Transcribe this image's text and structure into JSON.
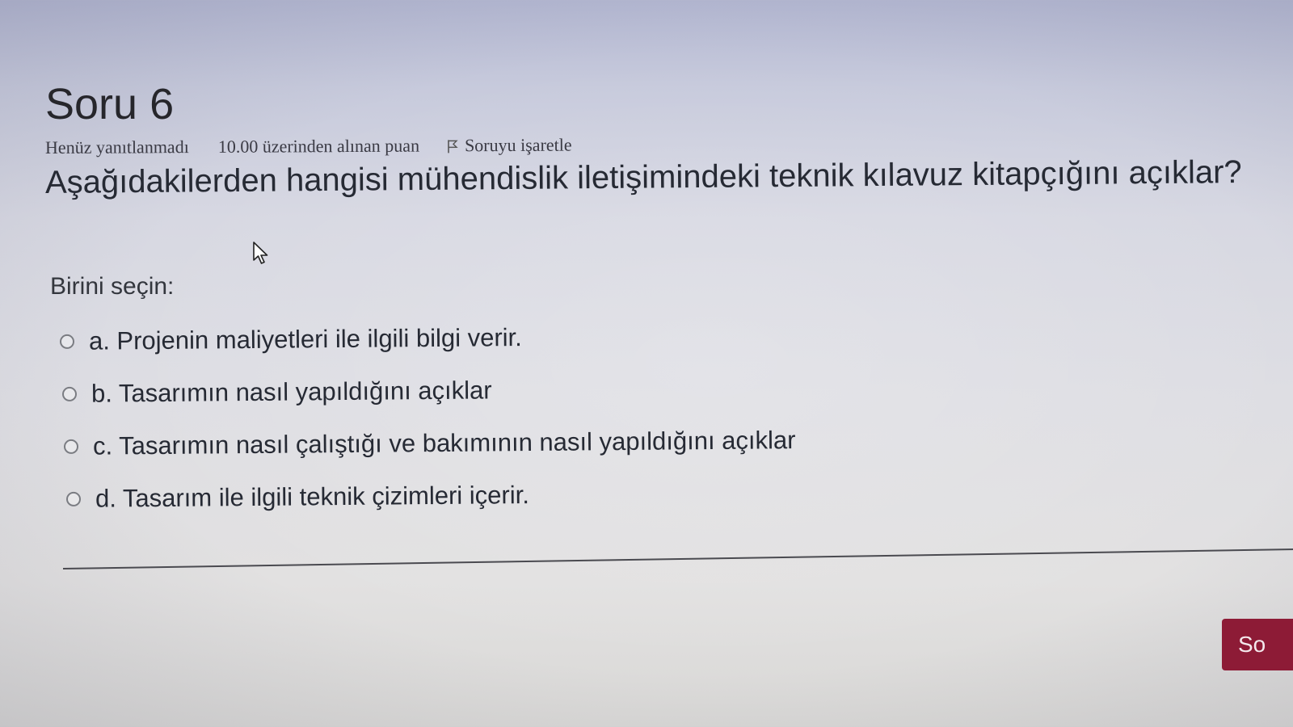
{
  "question": {
    "title": "Soru 6",
    "status": "Henüz yanıtlanmadı",
    "grade": "10.00 üzerinden alınan puan",
    "flag_label": "Soruyu işaretle",
    "flag_icon": "flag-icon",
    "text": "Aşağıdakilerden hangisi mühendislik iletişimindeki teknik kılavuz kitapçığını açıklar?"
  },
  "prompt": "Birini seçin:",
  "answers": [
    {
      "label": "a. Projenin maliyetleri ile ilgili bilgi verir."
    },
    {
      "label": "b. Tasarımın nasıl yapıldığını açıklar"
    },
    {
      "label": "c. Tasarımın nasıl çalıştığı ve bakımının nasıl yapıldığını açıklar"
    },
    {
      "label": "d. Tasarım ile ilgili teknik çizimleri içerir."
    }
  ],
  "next_button": {
    "label": "So",
    "color": "#8d1b36"
  },
  "cursor_icon": "mouse-pointer-icon"
}
